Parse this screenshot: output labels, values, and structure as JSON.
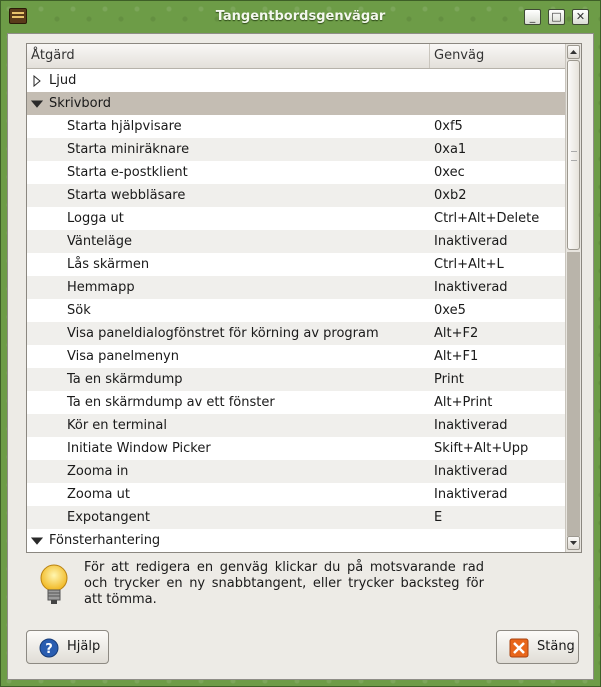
{
  "window": {
    "title": "Tangentbordsgenvägar",
    "controls": {
      "minimize": "_",
      "maximize": "□",
      "close": "✕"
    }
  },
  "table": {
    "columns": {
      "action": "Åtgärd",
      "shortcut": "Genväg"
    },
    "rows": [
      {
        "kind": "group",
        "expanded": false,
        "label": "Ljud",
        "shortcut": ""
      },
      {
        "kind": "group",
        "expanded": true,
        "label": "Skrivbord",
        "shortcut": ""
      },
      {
        "kind": "item",
        "label": "Starta hjälpvisare",
        "shortcut": "0xf5"
      },
      {
        "kind": "item",
        "label": "Starta miniräknare",
        "shortcut": "0xa1"
      },
      {
        "kind": "item",
        "label": "Starta e-postklient",
        "shortcut": "0xec"
      },
      {
        "kind": "item",
        "label": "Starta webbläsare",
        "shortcut": "0xb2"
      },
      {
        "kind": "item",
        "label": "Logga ut",
        "shortcut": "Ctrl+Alt+Delete"
      },
      {
        "kind": "item",
        "label": "Vänteläge",
        "shortcut": "Inaktiverad"
      },
      {
        "kind": "item",
        "label": "Lås skärmen",
        "shortcut": "Ctrl+Alt+L"
      },
      {
        "kind": "item",
        "label": "Hemmapp",
        "shortcut": "Inaktiverad"
      },
      {
        "kind": "item",
        "label": "Sök",
        "shortcut": "0xe5"
      },
      {
        "kind": "item",
        "label": "Visa paneldialogfönstret för körning av program",
        "shortcut": "Alt+F2"
      },
      {
        "kind": "item",
        "label": "Visa panelmenyn",
        "shortcut": "Alt+F1"
      },
      {
        "kind": "item",
        "label": "Ta en skärmdump",
        "shortcut": "Print"
      },
      {
        "kind": "item",
        "label": "Ta en skärmdump av ett fönster",
        "shortcut": "Alt+Print"
      },
      {
        "kind": "item",
        "label": "Kör en terminal",
        "shortcut": "Inaktiverad"
      },
      {
        "kind": "item",
        "label": "Initiate Window Picker",
        "shortcut": "Skift+Alt+Upp"
      },
      {
        "kind": "item",
        "label": "Zooma in",
        "shortcut": "Inaktiverad"
      },
      {
        "kind": "item",
        "label": "Zooma ut",
        "shortcut": "Inaktiverad"
      },
      {
        "kind": "item",
        "label": "Expotangent",
        "shortcut": "E"
      },
      {
        "kind": "group",
        "expanded": true,
        "label": "Fönsterhantering",
        "shortcut": ""
      }
    ]
  },
  "hint": {
    "text": "För att redigera en genväg klickar du på motsvarande rad och trycker en ny snabbtangent, eller trycker backsteg för att tömma.",
    "icon": "lightbulb-icon"
  },
  "buttons": {
    "help": {
      "label": "Hjälp",
      "icon": "help-icon",
      "color": "#2a5db0"
    },
    "close": {
      "label": "Stäng",
      "icon": "close-x-icon",
      "color": "#e8661b"
    }
  },
  "colors": {
    "selected_group_row": "#c4bdb3",
    "window_frame": "#6d9c47"
  }
}
